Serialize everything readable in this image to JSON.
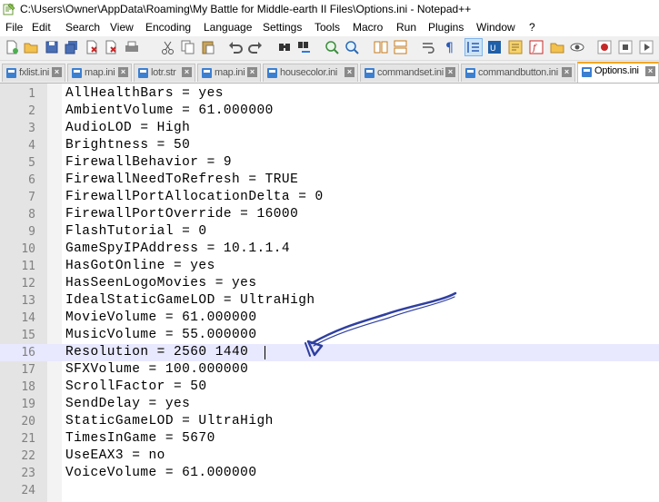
{
  "window": {
    "title": "C:\\Users\\Owner\\AppData\\Roaming\\My Battle for Middle-earth II Files\\Options.ini - Notepad++"
  },
  "menu": [
    "File",
    "Edit",
    "Search",
    "View",
    "Encoding",
    "Language",
    "Settings",
    "Tools",
    "Macro",
    "Run",
    "Plugins",
    "Window",
    "?"
  ],
  "toolbar": {
    "buttons": [
      "new-file-icon",
      "open-file-icon",
      "save-icon",
      "save-all-icon",
      "close-icon",
      "close-all-icon",
      "print-icon",
      "cut-icon",
      "copy-icon",
      "paste-icon",
      "undo-icon",
      "redo-icon",
      "find-icon",
      "replace-icon",
      "zoom-in-icon",
      "zoom-out-icon",
      "sync-vertical-icon",
      "sync-horizontal-icon",
      "word-wrap-icon",
      "show-all-characters-icon",
      "indent-guide-icon",
      "user-language-icon",
      "doc-map-icon",
      "function-list-icon",
      "folder-workspace-icon",
      "monitoring-icon",
      "record-macro-icon",
      "stop-record-icon",
      "play-macro-icon"
    ]
  },
  "tabs": [
    {
      "label": "fxlist.ini",
      "active": false
    },
    {
      "label": "map.ini",
      "active": false
    },
    {
      "label": "lotr.str",
      "active": false
    },
    {
      "label": "map.ini",
      "active": false
    },
    {
      "label": "housecolor.ini",
      "active": false
    },
    {
      "label": "commandset.ini",
      "active": false
    },
    {
      "label": "commandbutton.ini",
      "active": false
    },
    {
      "label": "Options.ini",
      "active": true
    }
  ],
  "editor": {
    "current_line": 16,
    "lines": [
      {
        "num": "1",
        "text": "AllHealthBars = yes"
      },
      {
        "num": "2",
        "text": "AmbientVolume = 61.000000"
      },
      {
        "num": "3",
        "text": "AudioLOD = High"
      },
      {
        "num": "4",
        "text": "Brightness = 50"
      },
      {
        "num": "5",
        "text": "FirewallBehavior = 9"
      },
      {
        "num": "6",
        "text": "FirewallNeedToRefresh = TRUE"
      },
      {
        "num": "7",
        "text": "FirewallPortAllocationDelta = 0"
      },
      {
        "num": "8",
        "text": "FirewallPortOverride = 16000"
      },
      {
        "num": "9",
        "text": "FlashTutorial = 0"
      },
      {
        "num": "10",
        "text": "GameSpyIPAddress = 10.1.1.4"
      },
      {
        "num": "11",
        "text": "HasGotOnline = yes"
      },
      {
        "num": "12",
        "text": "HasSeenLogoMovies = yes"
      },
      {
        "num": "13",
        "text": "IdealStaticGameLOD = UltraHigh"
      },
      {
        "num": "14",
        "text": "MovieVolume = 61.000000"
      },
      {
        "num": "15",
        "text": "MusicVolume = 55.000000"
      },
      {
        "num": "16",
        "text": "Resolution = 2560 1440"
      },
      {
        "num": "17",
        "text": "SFXVolume = 100.000000"
      },
      {
        "num": "18",
        "text": "ScrollFactor = 50"
      },
      {
        "num": "19",
        "text": "SendDelay = yes"
      },
      {
        "num": "20",
        "text": "StaticGameLOD = UltraHigh"
      },
      {
        "num": "21",
        "text": "TimesInGame = 5670"
      },
      {
        "num": "22",
        "text": "UseEAX3 = no"
      },
      {
        "num": "23",
        "text": "VoiceVolume = 61.000000"
      },
      {
        "num": "24",
        "text": ""
      }
    ]
  },
  "colors": {
    "current_line_highlight": "#e8e8ff",
    "annotation_arrow": "#2f3fa0",
    "active_tab_accent": "#f5a623"
  }
}
